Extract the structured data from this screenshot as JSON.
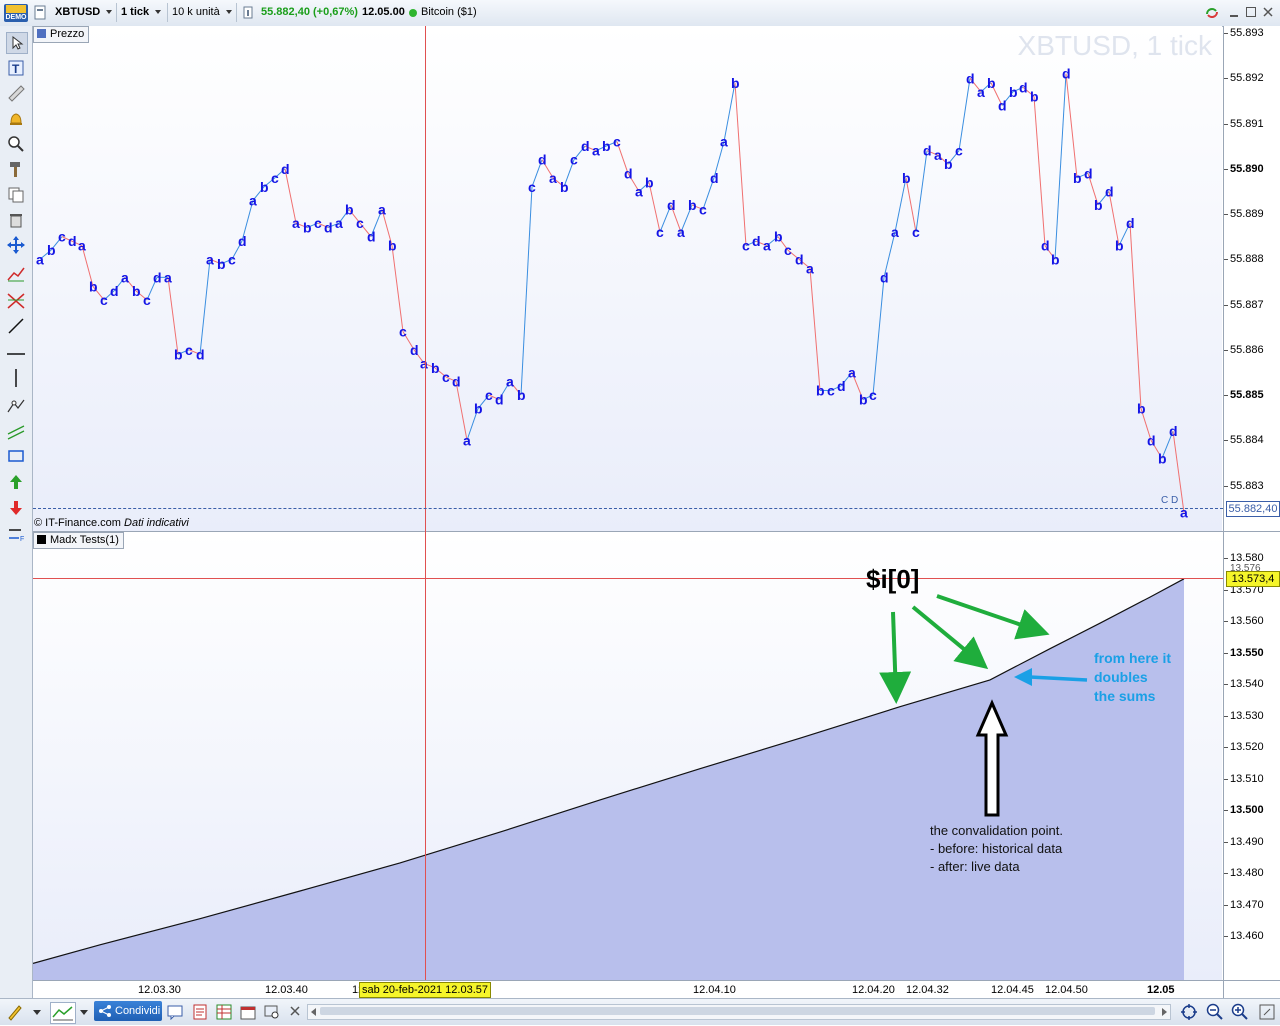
{
  "toolbar": {
    "demo_badge": "DEMO",
    "symbol": "XBTUSD",
    "timeframe": "1 tick",
    "units": "10 k unità",
    "price": "55.882,40",
    "change": "(+0,67%)",
    "time": "12.05.00",
    "instrument_name": "Bitcoin ($1)"
  },
  "price_panel": {
    "tab_label": "Prezzo",
    "watermark": "XBTUSD, 1 tick",
    "copyright": "© IT-Finance.com",
    "disclaimer": "Dati indicativi",
    "current_price_tag": "55.882,40",
    "cd_label": "C D",
    "y_ticks": [
      "55.893",
      "55.892",
      "55.891",
      "55.890",
      "55.889",
      "55.888",
      "55.887",
      "55.886",
      "55.885",
      "55.884",
      "55.883"
    ],
    "bold_ticks": [
      "55.890",
      "55.885"
    ]
  },
  "indicator_panel": {
    "tab_label": "Madx Tests(1)",
    "value_tag": "13.573,4",
    "hidden_tick": "13.576",
    "y_ticks": [
      "13.580",
      "13.570",
      "13.560",
      "13.550",
      "13.540",
      "13.530",
      "13.520",
      "13.510",
      "13.500",
      "13.490",
      "13.480",
      "13.470",
      "13.460"
    ],
    "bold_ticks": [
      "13.550",
      "13.500"
    ]
  },
  "annotations": {
    "var_label": "$i[0]",
    "blue_note": [
      "from here it",
      "doubles",
      "the sums"
    ],
    "black_note": [
      "the convalidation point.",
      "- before: historical data",
      "- after: live data"
    ],
    "colors": {
      "green": "#1fad3c",
      "blue": "#1aa0e6",
      "black": "#000000"
    }
  },
  "x_axis": {
    "ticks": [
      "12.03.30",
      "12.03.40",
      "12.04.10",
      "12.04.20",
      "12.04.32",
      "12.04.45",
      "12.04.50",
      "12.05"
    ],
    "cursor_label": "sab 20-feb-2021 12.03.57",
    "cursor_prefix": "12"
  },
  "bottom": {
    "share_label": "Condividi"
  },
  "colors": {
    "up": "#3a8ee0",
    "down": "#f07070",
    "label": "#1414e6",
    "area": "#b8bfec",
    "crosshair": "#e05050",
    "price_positive": "#1a9e1a"
  },
  "chart_data": [
    {
      "type": "line",
      "title": "XBTUSD, 1 tick",
      "ylim": [
        55882.3,
        55893.1
      ],
      "x_ticks": [
        "12.03.30",
        "12.03.40",
        "12.04.10",
        "12.04.20",
        "12.04.32",
        "12.04.45",
        "12.04.50",
        "12.05"
      ],
      "last_value": 55882.4,
      "points": [
        {
          "x": 40,
          "y": 55888.0,
          "l": "a"
        },
        {
          "x": 51,
          "y": 55888.2,
          "l": "b"
        },
        {
          "x": 62,
          "y": 55888.5,
          "l": "c"
        },
        {
          "x": 72,
          "y": 55888.4,
          "l": "d"
        },
        {
          "x": 82,
          "y": 55888.3,
          "l": "a"
        },
        {
          "x": 93,
          "y": 55887.4,
          "l": "b"
        },
        {
          "x": 104,
          "y": 55887.1,
          "l": "c"
        },
        {
          "x": 114,
          "y": 55887.3,
          "l": "d"
        },
        {
          "x": 125,
          "y": 55887.6,
          "l": "a"
        },
        {
          "x": 136,
          "y": 55887.3,
          "l": "b"
        },
        {
          "x": 147,
          "y": 55887.1,
          "l": "c"
        },
        {
          "x": 157,
          "y": 55887.6,
          "l": "d"
        },
        {
          "x": 168,
          "y": 55887.6,
          "l": "a"
        },
        {
          "x": 178,
          "y": 55885.9,
          "l": "b"
        },
        {
          "x": 189,
          "y": 55886.0,
          "l": "c"
        },
        {
          "x": 200,
          "y": 55885.9,
          "l": "d"
        },
        {
          "x": 210,
          "y": 55888.0,
          "l": "a"
        },
        {
          "x": 221,
          "y": 55887.9,
          "l": "b"
        },
        {
          "x": 232,
          "y": 55888.0,
          "l": "c"
        },
        {
          "x": 242,
          "y": 55888.4,
          "l": "d"
        },
        {
          "x": 253,
          "y": 55889.3,
          "l": "a"
        },
        {
          "x": 264,
          "y": 55889.6,
          "l": "b"
        },
        {
          "x": 275,
          "y": 55889.8,
          "l": "c"
        },
        {
          "x": 285,
          "y": 55890.0,
          "l": "d"
        },
        {
          "x": 296,
          "y": 55888.8,
          "l": "a"
        },
        {
          "x": 307,
          "y": 55888.7,
          "l": "b"
        },
        {
          "x": 318,
          "y": 55888.8,
          "l": "c"
        },
        {
          "x": 328,
          "y": 55888.7,
          "l": "d"
        },
        {
          "x": 339,
          "y": 55888.8,
          "l": "a"
        },
        {
          "x": 349,
          "y": 55889.1,
          "l": "b"
        },
        {
          "x": 360,
          "y": 55888.8,
          "l": "c"
        },
        {
          "x": 371,
          "y": 55888.5,
          "l": "d"
        },
        {
          "x": 382,
          "y": 55889.1,
          "l": "a"
        },
        {
          "x": 392,
          "y": 55888.3,
          "l": "b"
        },
        {
          "x": 403,
          "y": 55886.4,
          "l": "c"
        },
        {
          "x": 414,
          "y": 55886.0,
          "l": "d"
        },
        {
          "x": 424,
          "y": 55885.7,
          "l": "a"
        },
        {
          "x": 435,
          "y": 55885.6,
          "l": "b"
        },
        {
          "x": 446,
          "y": 55885.4,
          "l": "c"
        },
        {
          "x": 456,
          "y": 55885.3,
          "l": "d"
        },
        {
          "x": 467,
          "y": 55884.0,
          "l": "a"
        },
        {
          "x": 478,
          "y": 55884.7,
          "l": "b"
        },
        {
          "x": 489,
          "y": 55885.0,
          "l": "c"
        },
        {
          "x": 499,
          "y": 55884.9,
          "l": "d"
        },
        {
          "x": 510,
          "y": 55885.3,
          "l": "a"
        },
        {
          "x": 521,
          "y": 55885.0,
          "l": "b"
        },
        {
          "x": 532,
          "y": 55889.6,
          "l": "c"
        },
        {
          "x": 542,
          "y": 55890.2,
          "l": "d"
        },
        {
          "x": 553,
          "y": 55889.8,
          "l": "a"
        },
        {
          "x": 564,
          "y": 55889.6,
          "l": "b"
        },
        {
          "x": 574,
          "y": 55890.2,
          "l": "c"
        },
        {
          "x": 585,
          "y": 55890.5,
          "l": "d"
        },
        {
          "x": 596,
          "y": 55890.4,
          "l": "a"
        },
        {
          "x": 606,
          "y": 55890.5,
          "l": "b"
        },
        {
          "x": 617,
          "y": 55890.6,
          "l": "c"
        },
        {
          "x": 628,
          "y": 55889.9,
          "l": "d"
        },
        {
          "x": 639,
          "y": 55889.5,
          "l": "a"
        },
        {
          "x": 649,
          "y": 55889.7,
          "l": "b"
        },
        {
          "x": 660,
          "y": 55888.6,
          "l": "c"
        },
        {
          "x": 671,
          "y": 55889.2,
          "l": "d"
        },
        {
          "x": 681,
          "y": 55888.6,
          "l": "a"
        },
        {
          "x": 692,
          "y": 55889.2,
          "l": "b"
        },
        {
          "x": 703,
          "y": 55889.1,
          "l": "c"
        },
        {
          "x": 714,
          "y": 55889.8,
          "l": "d"
        },
        {
          "x": 724,
          "y": 55890.6,
          "l": "a"
        },
        {
          "x": 735,
          "y": 55891.9,
          "l": "b"
        },
        {
          "x": 746,
          "y": 55888.3,
          "l": "c"
        },
        {
          "x": 756,
          "y": 55888.4,
          "l": "d"
        },
        {
          "x": 767,
          "y": 55888.3,
          "l": "a"
        },
        {
          "x": 778,
          "y": 55888.5,
          "l": "b"
        },
        {
          "x": 788,
          "y": 55888.2,
          "l": "c"
        },
        {
          "x": 799,
          "y": 55888.0,
          "l": "d"
        },
        {
          "x": 810,
          "y": 55887.8,
          "l": "a"
        },
        {
          "x": 820,
          "y": 55885.1,
          "l": "b"
        },
        {
          "x": 831,
          "y": 55885.1,
          "l": "c"
        },
        {
          "x": 841,
          "y": 55885.2,
          "l": "d"
        },
        {
          "x": 852,
          "y": 55885.5,
          "l": "a"
        },
        {
          "x": 863,
          "y": 55884.9,
          "l": "b"
        },
        {
          "x": 873,
          "y": 55885.0,
          "l": "c"
        },
        {
          "x": 884,
          "y": 55887.6,
          "l": "d"
        },
        {
          "x": 895,
          "y": 55888.6,
          "l": "a"
        },
        {
          "x": 906,
          "y": 55889.8,
          "l": "b"
        },
        {
          "x": 916,
          "y": 55888.6,
          "l": "c"
        },
        {
          "x": 927,
          "y": 55890.4,
          "l": "d"
        },
        {
          "x": 938,
          "y": 55890.3,
          "l": "a"
        },
        {
          "x": 948,
          "y": 55890.1,
          "l": "b"
        },
        {
          "x": 959,
          "y": 55890.4,
          "l": "c"
        },
        {
          "x": 970,
          "y": 55892.0,
          "l": "d"
        },
        {
          "x": 981,
          "y": 55891.7,
          "l": "a"
        },
        {
          "x": 991,
          "y": 55891.9,
          "l": "b"
        },
        {
          "x": 1002,
          "y": 55891.4,
          "l": "d"
        },
        {
          "x": 1013,
          "y": 55891.7,
          "l": "b"
        },
        {
          "x": 1023,
          "y": 55891.8,
          "l": "d"
        },
        {
          "x": 1034,
          "y": 55891.6,
          "l": "b"
        },
        {
          "x": 1045,
          "y": 55888.3,
          "l": "d"
        },
        {
          "x": 1055,
          "y": 55888.0,
          "l": "b"
        },
        {
          "x": 1066,
          "y": 55892.1,
          "l": "d"
        },
        {
          "x": 1077,
          "y": 55889.8,
          "l": "b"
        },
        {
          "x": 1088,
          "y": 55889.9,
          "l": "d"
        },
        {
          "x": 1098,
          "y": 55889.2,
          "l": "b"
        },
        {
          "x": 1109,
          "y": 55889.5,
          "l": "d"
        },
        {
          "x": 1119,
          "y": 55888.3,
          "l": "b"
        },
        {
          "x": 1130,
          "y": 55888.8,
          "l": "d"
        },
        {
          "x": 1141,
          "y": 55884.7,
          "l": "b"
        },
        {
          "x": 1151,
          "y": 55884.0,
          "l": "d"
        },
        {
          "x": 1162,
          "y": 55883.6,
          "l": "b"
        },
        {
          "x": 1173,
          "y": 55884.2,
          "l": "d"
        },
        {
          "x": 1184,
          "y": 55882.4,
          "l": "a"
        }
      ]
    },
    {
      "type": "area",
      "title": "Madx Tests(1)",
      "ylim": [
        13452,
        13584
      ],
      "last_value": 13573.4,
      "points": [
        {
          "x": 33,
          "y": 13451.3
        },
        {
          "x": 100,
          "y": 13457.2
        },
        {
          "x": 200,
          "y": 13465.5
        },
        {
          "x": 300,
          "y": 13474.3
        },
        {
          "x": 400,
          "y": 13483.2
        },
        {
          "x": 500,
          "y": 13493.0
        },
        {
          "x": 600,
          "y": 13503.2
        },
        {
          "x": 700,
          "y": 13513.1
        },
        {
          "x": 800,
          "y": 13522.8
        },
        {
          "x": 900,
          "y": 13532.8
        },
        {
          "x": 990,
          "y": 13541.3
        },
        {
          "x": 1050,
          "y": 13551.2
        },
        {
          "x": 1100,
          "y": 13559.3
        },
        {
          "x": 1150,
          "y": 13567.6
        },
        {
          "x": 1184,
          "y": 13573.4
        }
      ]
    }
  ]
}
